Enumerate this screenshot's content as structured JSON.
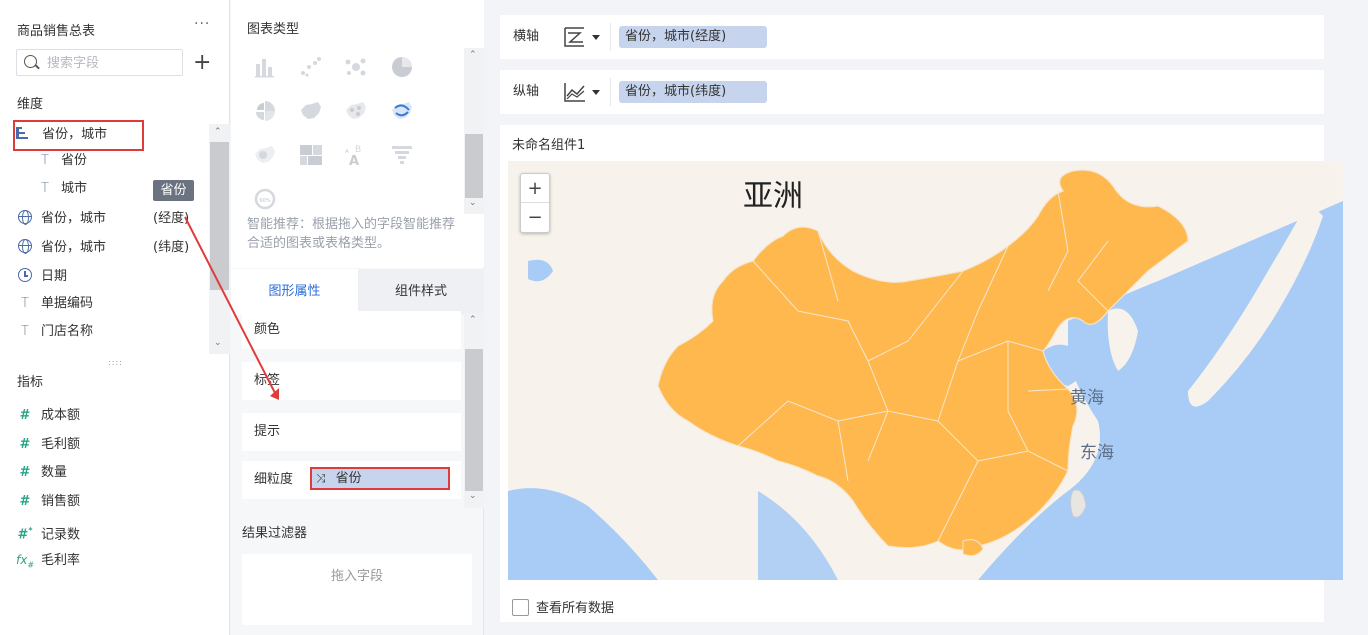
{
  "left_panel": {
    "title": "商品销售总表",
    "more": "···",
    "search": {
      "placeholder": "搜索字段",
      "value": ""
    },
    "add": "+",
    "dimension_title": "维度",
    "dimensions": [
      {
        "label": "省份，城市",
        "icon": "hierarchy-icon"
      },
      {
        "label": "省份",
        "icon": "text-field-icon"
      },
      {
        "label": "城市",
        "icon": "text-field-icon"
      },
      {
        "label": "省份，城市",
        "aside": "(经度)",
        "icon": "globe-icon"
      },
      {
        "label": "省份，城市",
        "aside": "(纬度)",
        "icon": "globe-icon"
      },
      {
        "label": "日期",
        "icon": "clock-icon"
      },
      {
        "label": "单据编码",
        "icon": "text-field-icon"
      },
      {
        "label": "门店名称",
        "icon": "text-field-icon"
      }
    ],
    "drag_badge": "省份",
    "measure_title": "指标",
    "measures": [
      {
        "label": "成本额",
        "icon": "#"
      },
      {
        "label": "毛利额",
        "icon": "#"
      },
      {
        "label": "数量",
        "icon": "#"
      },
      {
        "label": "销售额",
        "icon": "#"
      },
      {
        "label": "记录数",
        "icon": "#*"
      },
      {
        "label": "毛利率",
        "icon": "fx#"
      }
    ]
  },
  "middle_panel": {
    "chart_type_title": "图表类型",
    "smart_tip": "智能推荐：根据拖入的字段智能推荐合适的图表或表格类型。",
    "tabs": [
      "图形属性",
      "组件样式"
    ],
    "properties": [
      "颜色",
      "标签",
      "提示"
    ],
    "granularity_label": "细粒度",
    "granularity_value": "省份",
    "filter_title": "结果过滤器",
    "filter_placeholder": "拖入字段"
  },
  "right_panel": {
    "x_axis": {
      "label": "横轴",
      "field": "省份，城市(经度)"
    },
    "y_axis": {
      "label": "纵轴",
      "field": "省份，城市(纬度)"
    },
    "component_title": "未命名组件1",
    "map_labels": {
      "asia": "亚洲",
      "yellow_sea": "黄海",
      "east_sea": "东海"
    },
    "zoom_in": "+",
    "zoom_out": "−",
    "view_all": "查看所有数据"
  },
  "colors": {
    "accent": "#2a6ad9",
    "pill": "#c7d4ee",
    "annotation_red": "#e03b3b",
    "map_land": "#ffb84d",
    "map_sea": "#a8ccf5",
    "map_bg": "#f7f3ec"
  }
}
